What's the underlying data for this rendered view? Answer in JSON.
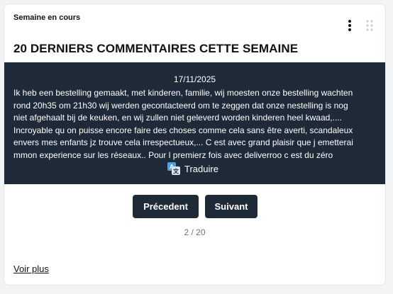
{
  "widget": {
    "period_label": "Semaine en cours",
    "title": "20 DERNIERS COMMENTAIRES CETTE SEMAINE"
  },
  "comment": {
    "date": "17/11/2025",
    "text": "Ik heb een bestelling gemaakt, met kinderen, familie, wij moesten onze bestelling wachten\nrond 20h35 om 21h30 wij werden gecontacteerd om te zeggen dat onze nestelling is nog\nniet afgehaalt bij de keuken, en wij zullen niet geleverd worden kinderen heel kwaad,....\nIncroyable qu on puisse encore faire des choses comme cela sans être averti, scandaleux\nenvers mes enfants jz trouve cela irrespectueux,... C est avec grand plaisir que j emetterai\nmmon experience sur les réseaux.. Pour l premierz fois avec deliverroo c est du zéro",
    "translate_label": "Traduire"
  },
  "pagination": {
    "prev_label": "Précedent",
    "next_label": "Suivant",
    "indicator": "2 / 20",
    "current": 2,
    "total": 20
  },
  "footer": {
    "see_more_label": "Voir plus"
  },
  "icons": {
    "menu": "more-vertical-icon",
    "drag": "drag-handle-icon",
    "translate": "translate-icon"
  },
  "colors": {
    "panel_bg": "#1e2a38",
    "button_bg": "#1e2a38",
    "translate_icon": "#4aa3df"
  }
}
